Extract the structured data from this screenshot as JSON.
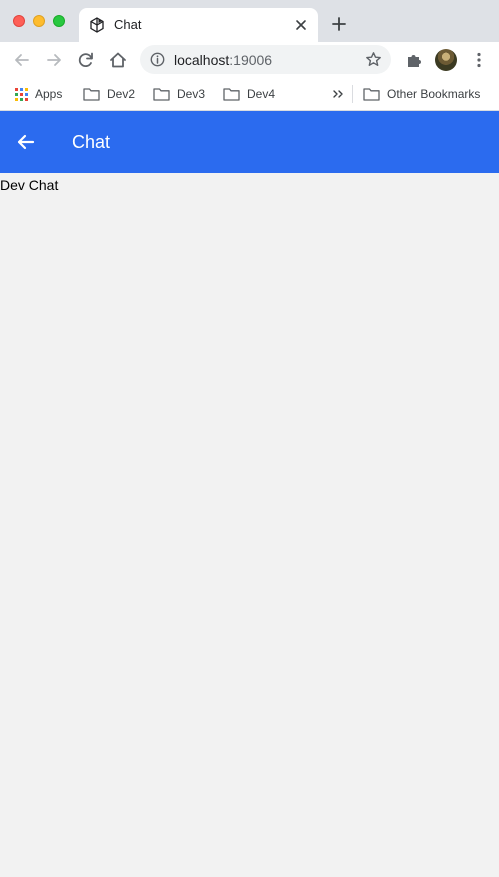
{
  "browser": {
    "tab": {
      "title": "Chat"
    },
    "address_bar": {
      "host": "localhost",
      "port": ":19006"
    },
    "bookmarks": [
      {
        "label": "Apps",
        "icon": "apps-grid-icon"
      },
      {
        "label": "Dev2",
        "icon": "folder-icon"
      },
      {
        "label": "Dev3",
        "icon": "folder-icon"
      },
      {
        "label": "Dev4",
        "icon": "folder-icon"
      },
      {
        "label": "Other Bookmarks",
        "icon": "folder-icon"
      }
    ]
  },
  "app": {
    "header": {
      "title": "Chat"
    },
    "content": {
      "text": "Dev Chat"
    }
  },
  "colors": {
    "app_bar": "#2b6bef",
    "tab_strip": "#dee1e6",
    "content_background": "#f2f2f2"
  }
}
